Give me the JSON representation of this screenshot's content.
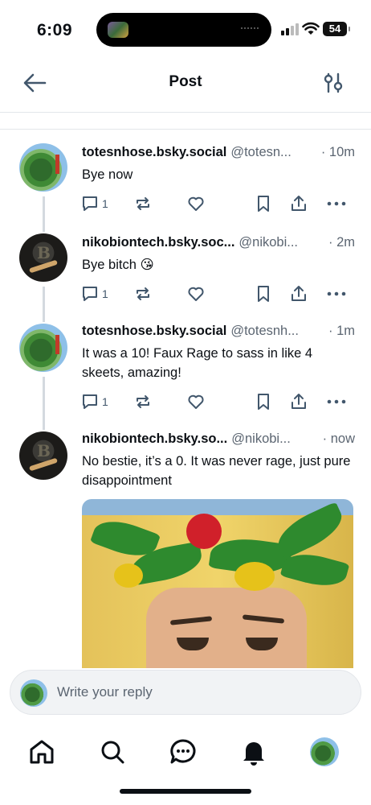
{
  "status_bar": {
    "time": "6:09",
    "battery": "54"
  },
  "header": {
    "title": "Post"
  },
  "posts": [
    {
      "display_name": "totesnhose.bsky.social",
      "handle": "@totesn...",
      "time": "· 10m",
      "text": "Bye now",
      "reply_count": "1",
      "avatar": "tree"
    },
    {
      "display_name": "nikobiontech.bsky.soc...",
      "handle": "@nikobi...",
      "time": "· 2m",
      "text": "Bye bitch 😘",
      "reply_count": "1",
      "avatar": "coin"
    },
    {
      "display_name": "totesnhose.bsky.social",
      "handle": "@totesnh...",
      "time": "· 1m",
      "text": "It was a 10! Faux Rage to sass in like 4 skeets, amazing!",
      "reply_count": "1",
      "avatar": "tree"
    },
    {
      "display_name": "nikobiontech.bsky.so...",
      "handle": "@nikobi...",
      "time": "· now",
      "text": "No bestie, it’s a 0. It was never rage, just pure disappointment",
      "avatar": "coin",
      "has_image": true
    }
  ],
  "reply": {
    "placeholder": "Write your reply"
  },
  "tabbar": {
    "items": [
      "home-icon",
      "search-icon",
      "chat-icon",
      "notifications-icon",
      "profile-avatar"
    ]
  },
  "colors": {
    "icon": "#42576c",
    "thread_line": "#d4d9df",
    "muted_text": "#5b6571"
  }
}
